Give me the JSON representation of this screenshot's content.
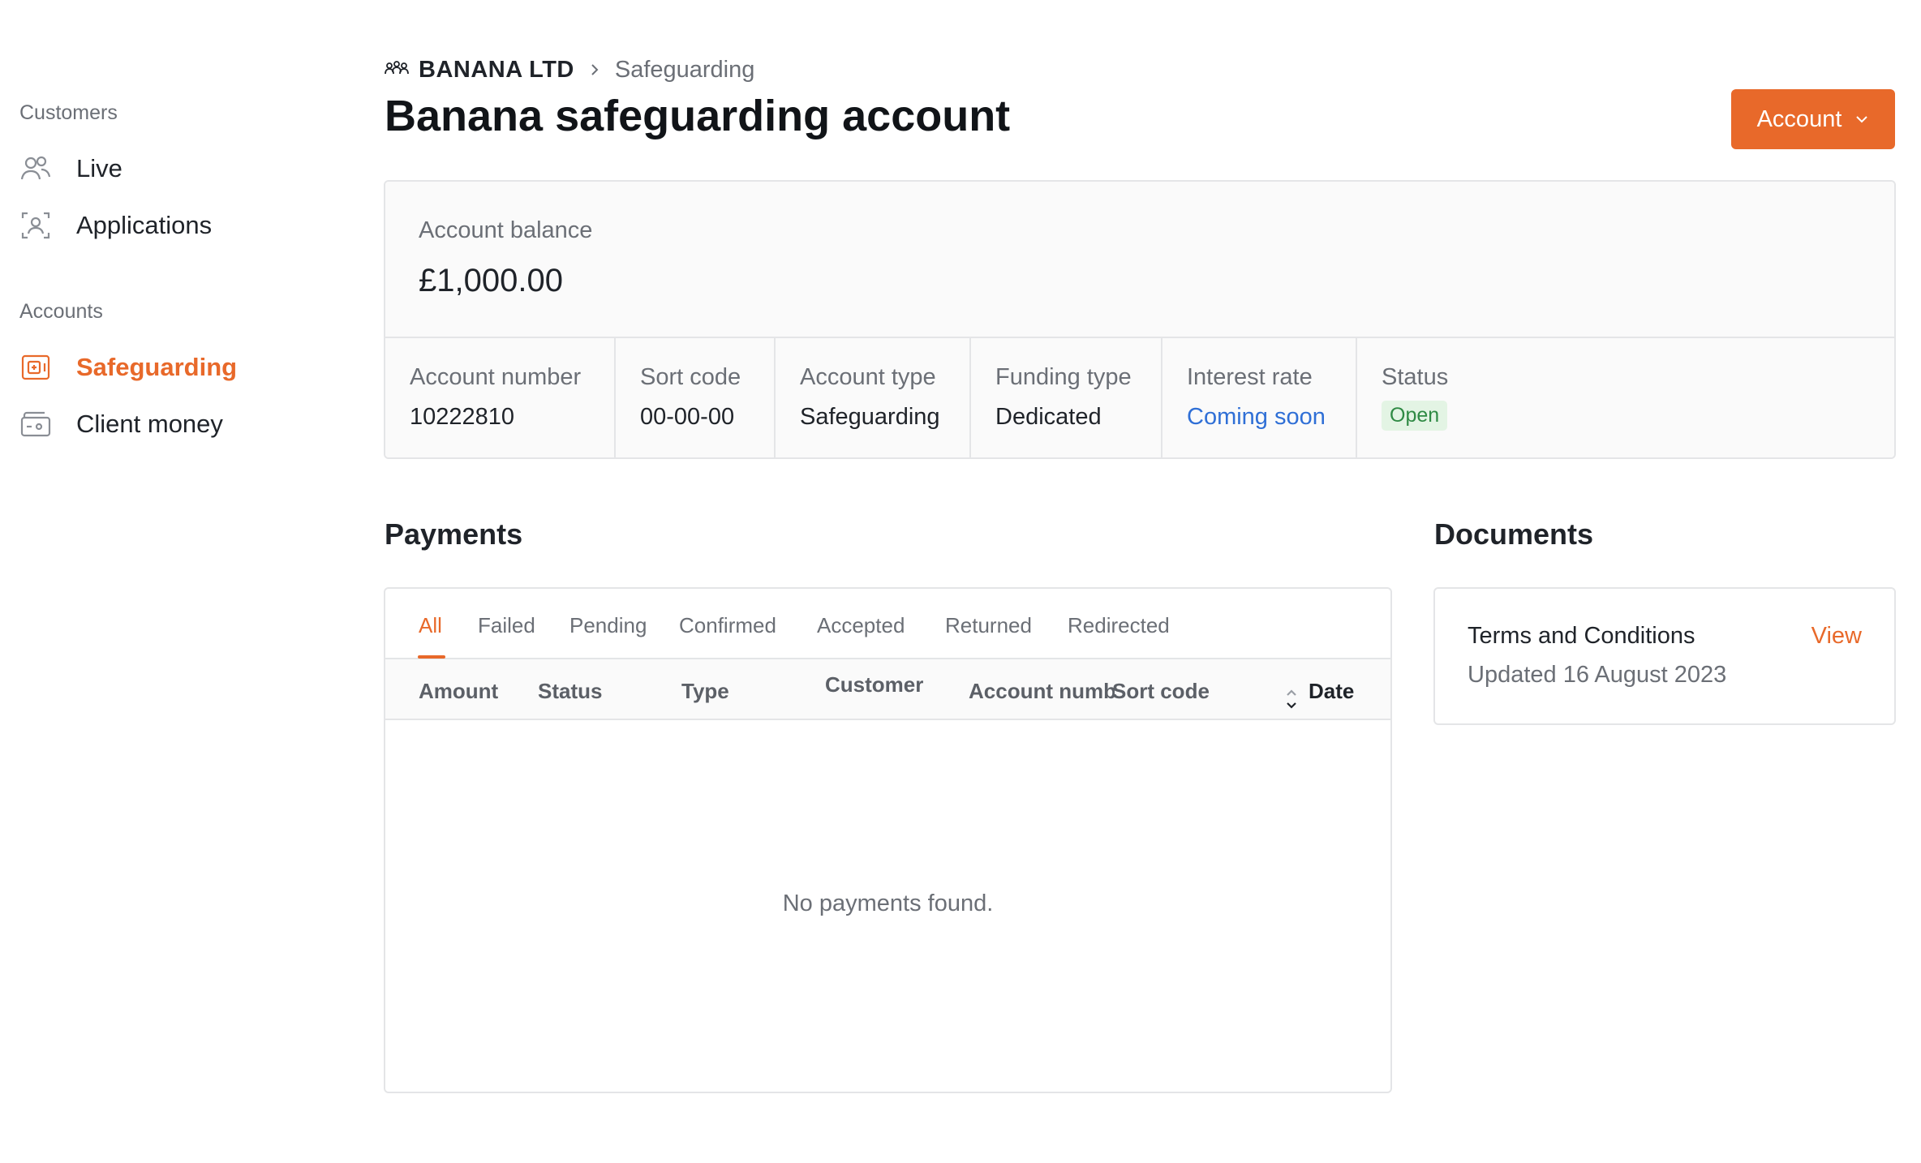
{
  "sidebar": {
    "customers_label": "Customers",
    "accounts_label": "Accounts",
    "items": [
      {
        "label": "Live",
        "icon": "users-icon"
      },
      {
        "label": "Applications",
        "icon": "user-scan-icon"
      },
      {
        "label": "Safeguarding",
        "icon": "safe-icon",
        "active": true
      },
      {
        "label": "Client money",
        "icon": "wallet-icon"
      }
    ]
  },
  "breadcrumb": {
    "org": "BANANA LTD",
    "current": "Safeguarding"
  },
  "page": {
    "title": "Banana safeguarding account",
    "account_button": "Account"
  },
  "account": {
    "balance_label": "Account balance",
    "balance_value": "£1,000.00",
    "fields": [
      {
        "key": "Account number",
        "value": "10222810"
      },
      {
        "key": "Sort code",
        "value": "00-00-00"
      },
      {
        "key": "Account type",
        "value": "Safeguarding"
      },
      {
        "key": "Funding type",
        "value": "Dedicated"
      },
      {
        "key": "Interest rate",
        "value": "Coming soon"
      },
      {
        "key": "Status",
        "value": "Open"
      }
    ]
  },
  "payments": {
    "title": "Payments",
    "tabs": [
      "All",
      "Failed",
      "Pending",
      "Confirmed",
      "Accepted",
      "Returned",
      "Redirected"
    ],
    "active_tab": "All",
    "columns": [
      "Amount",
      "Status",
      "Type",
      "Customer",
      "Account number",
      "Sort code",
      "Date"
    ],
    "empty_message": "No payments found."
  },
  "documents": {
    "title": "Documents",
    "items": [
      {
        "name": "Terms and Conditions",
        "updated": "Updated 16 August 2023",
        "action": "View"
      }
    ]
  },
  "colors": {
    "accent": "#e8692a",
    "link": "#2f6fd6",
    "status_open_bg": "#e3f4e4",
    "status_open_text": "#2f8a44"
  }
}
